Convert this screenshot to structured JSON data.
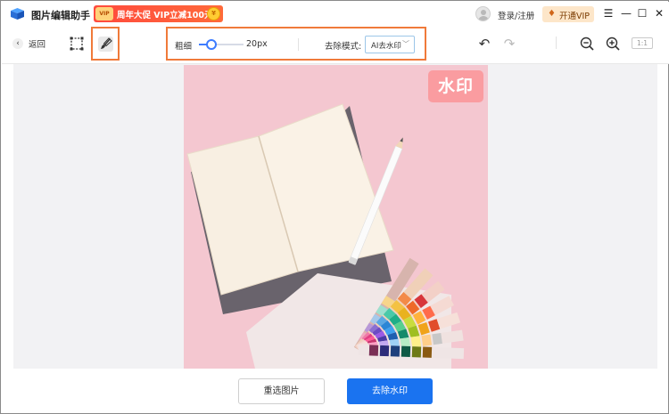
{
  "titlebar": {
    "app_name": "图片编辑助手",
    "promo": {
      "badge": "VIP",
      "text": "周年大促 VIP立减100元",
      "coin": "¥"
    },
    "login": "登录/注册",
    "vip_button": "开通VIP",
    "controls": {
      "menu": "☰",
      "minimize": "—",
      "maximize": "☐",
      "close": "✕"
    }
  },
  "toolbar": {
    "back_icon": "‹",
    "back_label": "返回",
    "tools": [
      {
        "name": "rect-select-icon",
        "active": false
      },
      {
        "name": "brush-icon",
        "active": true
      }
    ],
    "thickness": {
      "label": "粗细",
      "value": "20px",
      "level": 0.2
    },
    "mode": {
      "label": "去除模式:",
      "selected": "AI去水印"
    },
    "undo_icon": "↶",
    "redo_icon": "↷",
    "zoom_reset": "1:1"
  },
  "canvas": {
    "watermark_text": "水印"
  },
  "actions": {
    "reselect_label": "重选图片",
    "remove_label": "去除水印"
  },
  "colors": {
    "accent": "#1a73f0",
    "highlight": "#f07a3a",
    "promo": "#ff4a3d",
    "photo_bg": "#f4c7d0"
  }
}
